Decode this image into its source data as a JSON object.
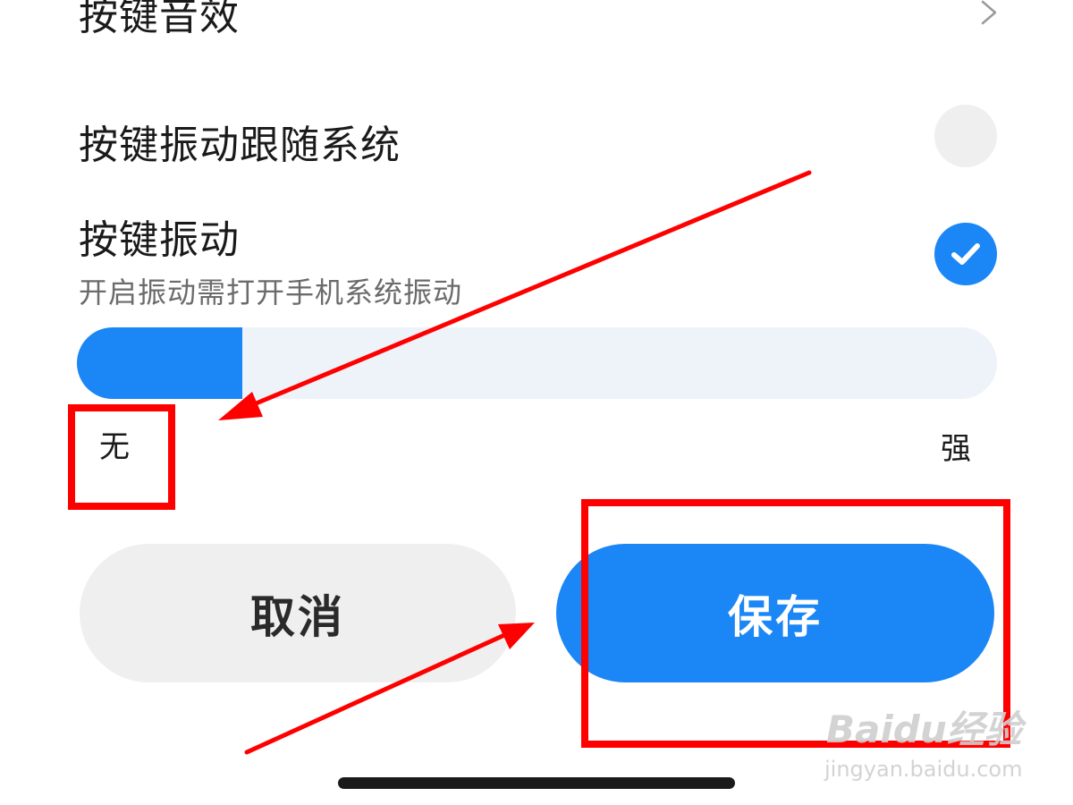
{
  "settings": {
    "key_sound": {
      "label": "按键音效"
    },
    "vibration_follow_system": {
      "label": "按键振动跟随系统",
      "checked": false
    },
    "key_vibration": {
      "label": "按键振动",
      "subtitle": "开启振动需打开手机系统振动",
      "checked": true
    },
    "vibration_strength": {
      "min_label": "无",
      "max_label": "强",
      "level_percent": 18
    }
  },
  "actions": {
    "cancel_label": "取消",
    "save_label": "保存"
  },
  "watermark": {
    "brand": "Baidu经验",
    "url": "jingyan.baidu.com"
  },
  "colors": {
    "accent": "#1b86f5",
    "track": "#eef2f9",
    "annotation": "#ff0000",
    "button_gray": "#efefef"
  },
  "icons": {
    "key_sound_row": "chevron-right-icon",
    "vibrate_checkbox": "checkmark-icon"
  }
}
